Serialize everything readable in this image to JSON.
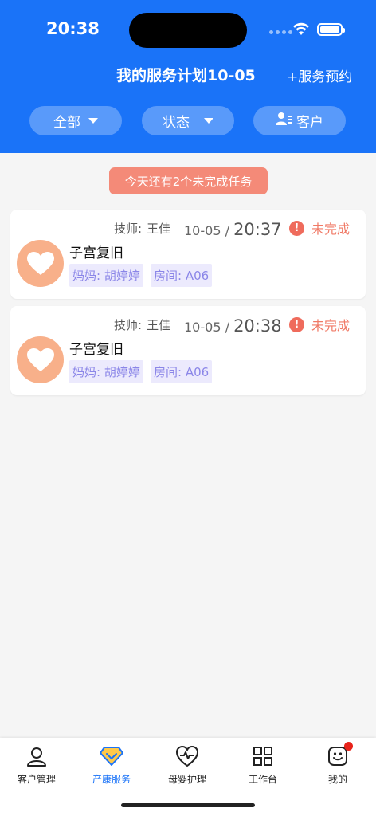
{
  "status_bar": {
    "time": "20:38"
  },
  "header": {
    "title": "我的服务计划10-05",
    "appointment_label": "+服务预约",
    "filters": [
      {
        "label": "全部",
        "icon": "caret-down-icon"
      },
      {
        "label": "状态",
        "icon": "caret-down-icon"
      },
      {
        "label": "客户",
        "icon": "user-card-icon"
      }
    ]
  },
  "notice": "今天还有2个未完成任务",
  "tasks": [
    {
      "tech_label": "技师:",
      "tech_name": "王佳",
      "date": "10-05 /",
      "time": "20:37",
      "status": "未完成",
      "service": "子宫复旧",
      "mother": "妈妈: 胡婷婷",
      "room": "房间: A06"
    },
    {
      "tech_label": "技师:",
      "tech_name": "王佳",
      "date": "10-05 /",
      "time": "20:38",
      "status": "未完成",
      "service": "子宫复旧",
      "mother": "妈妈: 胡婷婷",
      "room": "房间: A06"
    }
  ],
  "tabbar": {
    "items": [
      {
        "label": "客户管理",
        "icon": "user-outline-icon"
      },
      {
        "label": "产康服务",
        "icon": "diamond-icon",
        "active": true
      },
      {
        "label": "母婴护理",
        "icon": "heart-pulse-icon"
      },
      {
        "label": "工作台",
        "icon": "grid-icon"
      },
      {
        "label": "我的",
        "icon": "smile-face-icon",
        "has_badge": true
      }
    ]
  },
  "colors": {
    "primary": "#1a73f8",
    "warning": "#f07a66",
    "tag_bg": "#eceafd",
    "tag_text": "#8b86e8",
    "avatar": "#f8b08a"
  }
}
